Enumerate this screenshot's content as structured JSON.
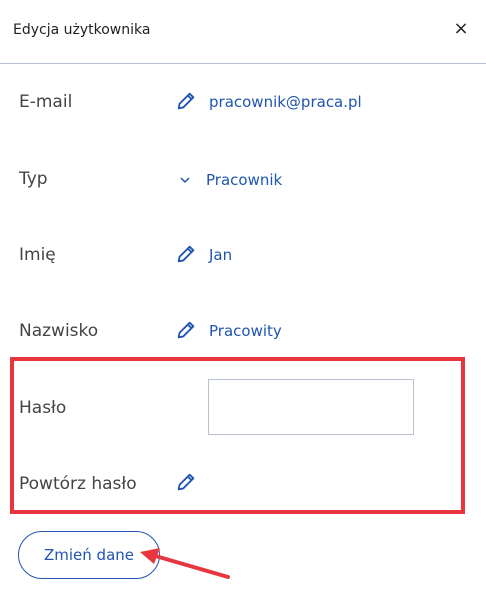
{
  "header": {
    "title": "Edycja użytkownika",
    "close_glyph": "×"
  },
  "fields": {
    "email": {
      "label": "E-mail",
      "value": "pracownik@praca.pl"
    },
    "type": {
      "label": "Typ",
      "value": "Pracownik"
    },
    "first_name": {
      "label": "Imię",
      "value": "Jan"
    },
    "last_name": {
      "label": "Nazwisko",
      "value": "Pracowity"
    },
    "password": {
      "label": "Hasło",
      "value": ""
    },
    "repeat_password": {
      "label": "Powtórz hasło"
    }
  },
  "actions": {
    "submit_label": "Zmień dane"
  },
  "colors": {
    "accent": "#1f55b1",
    "highlight": "#e8363e",
    "divider": "#b9c2cf"
  },
  "icons": [
    "close-icon",
    "pencil-icon",
    "chevron-down-icon",
    "arrow-annotation"
  ]
}
